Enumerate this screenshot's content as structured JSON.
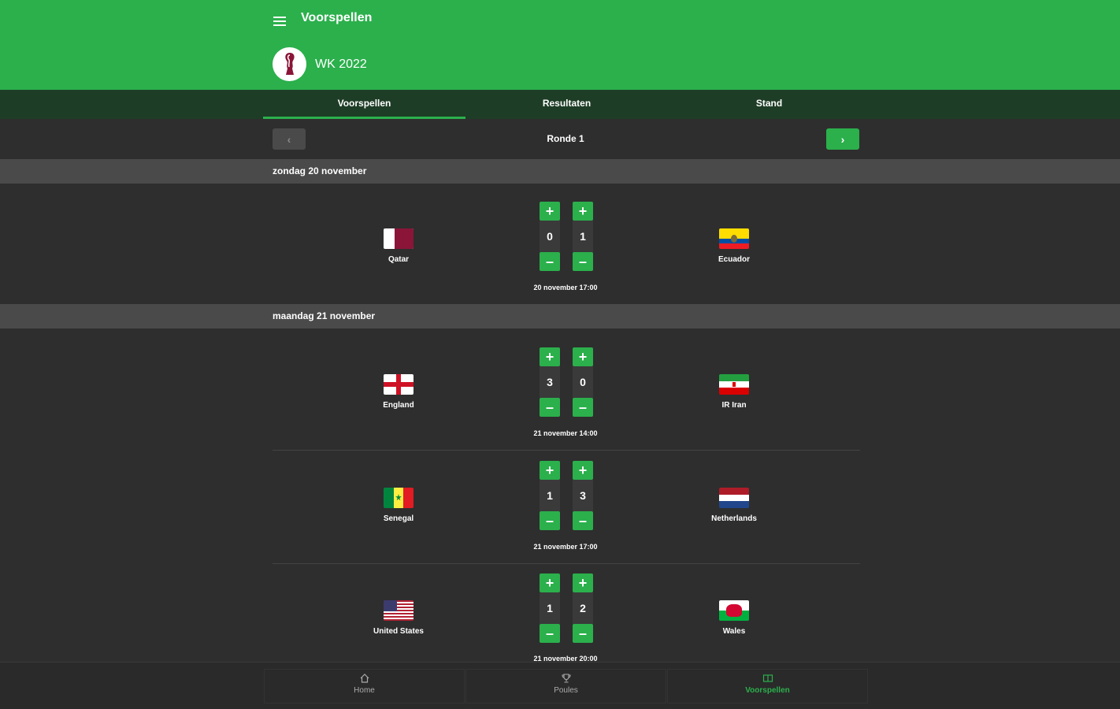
{
  "header": {
    "title": "Voorspellen",
    "pool_name": "WK 2022",
    "color": "#2bb04c"
  },
  "tabs": [
    {
      "label": "Voorspellen",
      "active": true
    },
    {
      "label": "Resultaten",
      "active": false
    },
    {
      "label": "Stand",
      "active": false
    }
  ],
  "round": {
    "label": "Ronde 1",
    "prev_icon": "chevron-left-icon",
    "next_icon": "chevron-right-icon",
    "prev_glyph": "‹",
    "next_glyph": "›"
  },
  "days": [
    {
      "label": "zondag 20 november"
    },
    {
      "label": "maandag 21 november"
    }
  ],
  "matches": [
    {
      "home": "Qatar",
      "away": "Ecuador",
      "home_score": "0",
      "away_score": "1",
      "kickoff": "20 november 17:00"
    },
    {
      "home": "England",
      "away": "IR Iran",
      "home_score": "3",
      "away_score": "0",
      "kickoff": "21 november 14:00"
    },
    {
      "home": "Senegal",
      "away": "Netherlands",
      "home_score": "1",
      "away_score": "3",
      "kickoff": "21 november 17:00"
    },
    {
      "home": "United States",
      "away": "Wales",
      "home_score": "1",
      "away_score": "2",
      "kickoff": "21 november 20:00"
    }
  ],
  "stepper": {
    "plus": "+",
    "minus": "–"
  },
  "bottom_nav": [
    {
      "label": "Home",
      "icon": "home-icon",
      "active": false
    },
    {
      "label": "Poules",
      "icon": "trophy-icon",
      "active": false
    },
    {
      "label": "Voorspellen",
      "icon": "scoreboard-icon",
      "active": true
    }
  ]
}
